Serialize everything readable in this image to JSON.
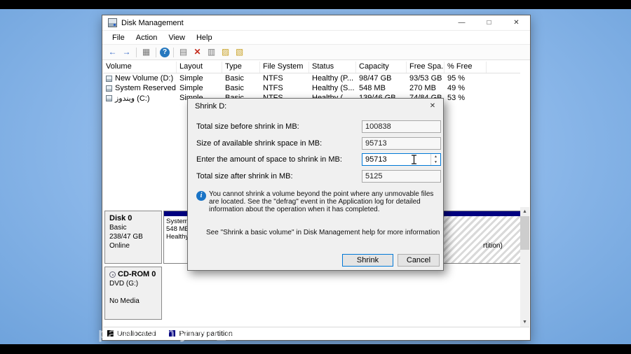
{
  "watermark": "parat.com/y0S0_ebrahimi2021",
  "colors": {
    "accent": "#0078d7",
    "primary_partition": "#000080",
    "desktop": "#8fbaeb"
  },
  "icons": {
    "spin_up": "▲",
    "spin_down": "▼",
    "scroll_up": "▲",
    "scroll_down": "▼",
    "info": "i"
  },
  "window": {
    "title": "Disk Management",
    "controls": {
      "minimize": "—",
      "maximize": "□",
      "close": "✕"
    },
    "menu": [
      "File",
      "Action",
      "View",
      "Help"
    ]
  },
  "toolbar": [
    {
      "name": "back",
      "glyph": "←"
    },
    {
      "name": "forward",
      "glyph": "→"
    },
    {
      "name": "console-tree",
      "glyph": "▦"
    },
    {
      "name": "help",
      "glyph": "?"
    },
    {
      "name": "properties",
      "glyph": "▤"
    },
    {
      "name": "delete",
      "glyph": "✕"
    },
    {
      "name": "chart",
      "glyph": "▥"
    },
    {
      "name": "open-folder",
      "glyph": "▨"
    },
    {
      "name": "new-folder",
      "glyph": "▧"
    }
  ],
  "table": {
    "columns": [
      "Volume",
      "Layout",
      "Type",
      "File System",
      "Status",
      "Capacity",
      "Free Spa...",
      "% Free"
    ],
    "rows": [
      {
        "volume": "New Volume (D:)",
        "layout": "Simple",
        "type": "Basic",
        "fs": "NTFS",
        "status": "Healthy (P...",
        "capacity": "98/47 GB",
        "free": "93/53 GB",
        "pct_free": "95 %"
      },
      {
        "volume": "System Reserved",
        "layout": "Simple",
        "type": "Basic",
        "fs": "NTFS",
        "status": "Healthy (S...",
        "capacity": "548 MB",
        "free": "270 MB",
        "pct_free": "49 %"
      },
      {
        "volume": "ويندوز (C:)",
        "layout": "Simple",
        "type": "Basic",
        "fs": "NTFS",
        "status": "Healthy (...",
        "capacity": "139/46 GB",
        "free": "74/84 GB",
        "pct_free": "53 %"
      }
    ]
  },
  "disks": {
    "disk0": {
      "name": "Disk 0",
      "type": "Basic",
      "size": "238/47 GB",
      "status": "Online"
    },
    "system_partition": {
      "line1": "System",
      "line2": "548 MB",
      "line3": "Healthy"
    },
    "d_partition_fragment": "rtition)",
    "cdrom": {
      "name": "CD-ROM 0",
      "type": "DVD (G:)",
      "status": "No Media"
    }
  },
  "legend": {
    "unallocated": "Unallocated",
    "primary": "Primary partition"
  },
  "dialog": {
    "title": "Shrink D:",
    "close": "✕",
    "fields": [
      {
        "label": "Total size before shrink in MB:",
        "value": "100838"
      },
      {
        "label": "Size of available shrink space in MB:",
        "value": "95713"
      },
      {
        "label": "Enter the amount of space to shrink in MB:",
        "value": "95713"
      },
      {
        "label": "Total size after shrink in MB:",
        "value": "5125"
      }
    ],
    "info": "You cannot shrink a volume beyond the point where any unmovable files are located. See the \"defrag\" event in the Application log for detailed information about the operation when it has completed.",
    "help": "See \"Shrink a basic volume\" in Disk Management help for more information",
    "shrink_button": "Shrink",
    "cancel_button": "Cancel"
  }
}
